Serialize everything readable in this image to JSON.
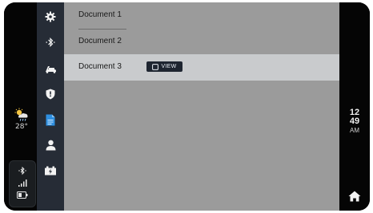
{
  "weather": {
    "icon": "partly-cloudy-rain-icon",
    "temperature": "28°"
  },
  "status": {
    "icons": [
      "bluetooth-icon",
      "signal-icon",
      "battery-icon"
    ]
  },
  "nav": {
    "items": [
      {
        "icon": "gear-icon",
        "active": false
      },
      {
        "icon": "bluetooth-icon",
        "active": false
      },
      {
        "icon": "scooter-icon",
        "active": false
      },
      {
        "icon": "shield-icon",
        "active": false
      },
      {
        "icon": "document-icon",
        "active": true
      },
      {
        "icon": "user-icon",
        "active": false
      },
      {
        "icon": "battery-charging-icon",
        "active": false
      }
    ]
  },
  "documents": [
    {
      "label": "Document 1",
      "selected": false
    },
    {
      "label": "Document 2",
      "selected": false
    },
    {
      "label": "Document 3",
      "selected": true,
      "action": "VIEW"
    }
  ],
  "clock": {
    "hour": "12",
    "minute": "49",
    "ampm": "AM"
  },
  "colors": {
    "accent": "#2f8fe0",
    "content_bg": "#9b9b9b",
    "selected_row": "#c9cbcd",
    "nav_bg": "#262c36"
  }
}
